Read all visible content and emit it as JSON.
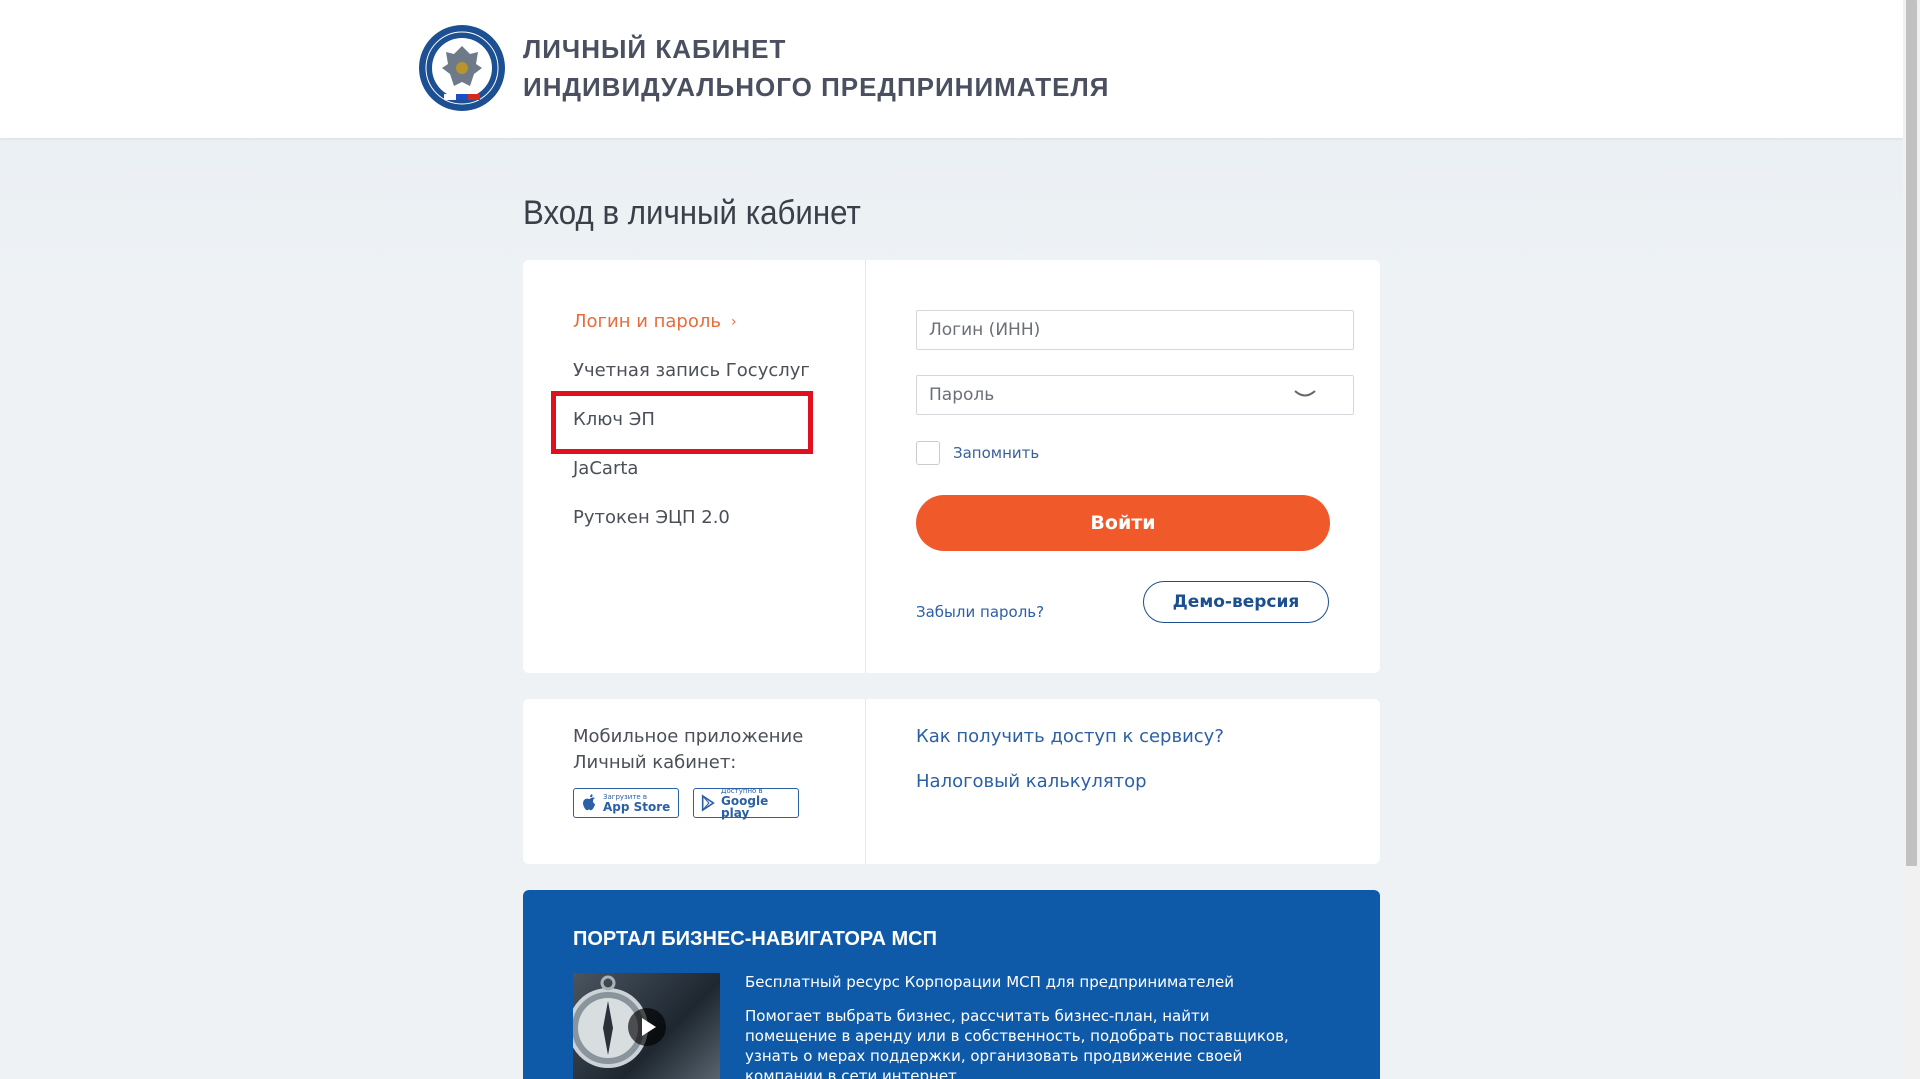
{
  "header": {
    "title_line1": "ЛИЧНЫЙ КАБИНЕТ",
    "title_line2": "ИНДИВИДУАЛЬНОГО ПРЕДПРИНИМАТЕЛЯ"
  },
  "page_title": "Вход в личный кабинет",
  "login_methods": [
    {
      "label": "Логин и пароль",
      "active": true
    },
    {
      "label": "Учетная запись Госуслуг"
    },
    {
      "label": "Ключ ЭП"
    },
    {
      "label": "JaCarta"
    },
    {
      "label": "Рутокен ЭЦП 2.0"
    }
  ],
  "form": {
    "login_placeholder": "Логин (ИНН)",
    "password_placeholder": "Пароль",
    "remember_label": "Запомнить",
    "submit_label": "Войти",
    "forgot_label": "Забыли пароль?",
    "demo_label": "Демо-версия"
  },
  "info": {
    "mobile_line1": "Мобильное приложение",
    "mobile_line2": "Личный кабинет:",
    "appstore_small": "Загрузите в",
    "appstore_big": "App Store",
    "gplay_small": "Доступно в",
    "gplay_big": "Google play",
    "link_access": "Как получить доступ к сервису?",
    "link_calc": "Налоговый калькулятор"
  },
  "banner": {
    "title": "ПОРТАЛ БИЗНЕС-НАВИГАТОРА МСП",
    "subtitle": "Бесплатный ресурс Корпорации МСП для предпринимателей",
    "description": "Помогает выбрать бизнес, рассчитать бизнес-план, найти помещение в аренду или в собственность, подобрать поставщиков, узнать о мерах поддержки, организовать продвижение своей компании в сети интернет."
  },
  "colors": {
    "accent_orange": "#f0592a",
    "link_blue": "#2b5fa6",
    "banner_blue": "#0f5aa8",
    "highlight_red": "#e0101e"
  }
}
